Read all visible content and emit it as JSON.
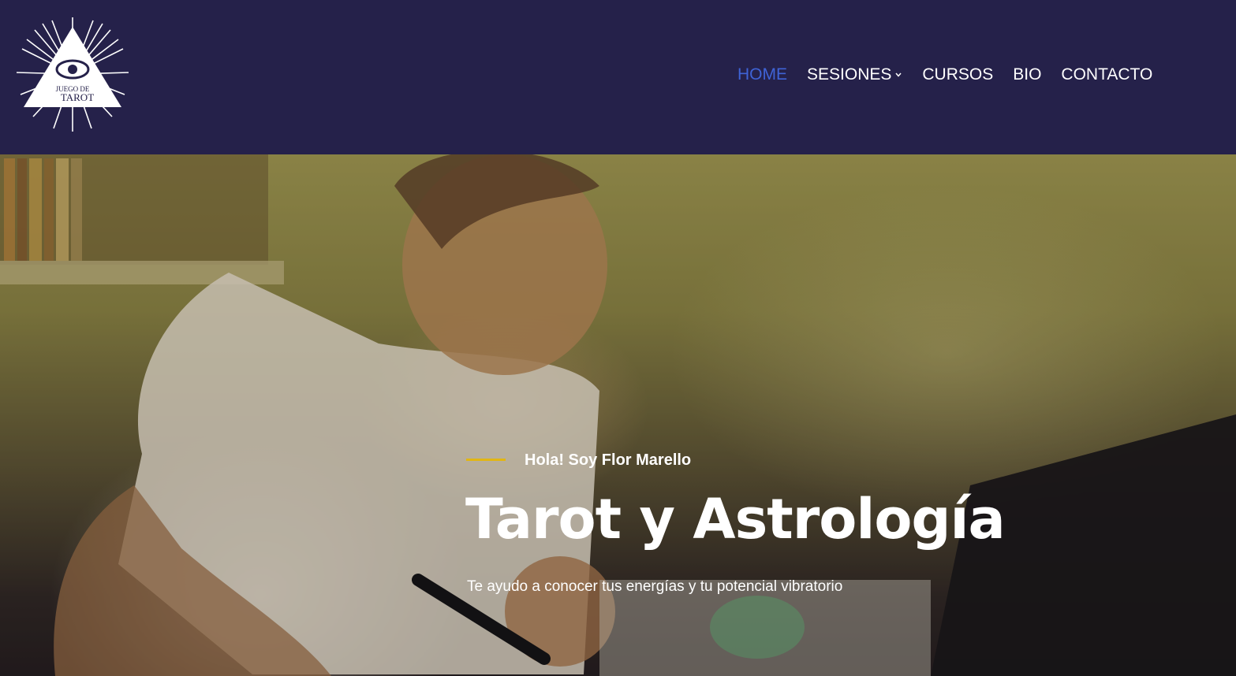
{
  "logo": {
    "line1": "JUEGO DE",
    "line2": "TAROT"
  },
  "nav": {
    "items": [
      {
        "label": "HOME",
        "active": true
      },
      {
        "label": "SESIONES",
        "has_dropdown": true
      },
      {
        "label": "CURSOS"
      },
      {
        "label": "BIO"
      },
      {
        "label": "CONTACTO"
      }
    ]
  },
  "hero": {
    "kicker": "Hola! Soy Flor Marello",
    "title": "Tarot y Astrología",
    "subtitle": "Te ayudo a conocer tus energías y tu potencial vibratorio"
  },
  "colors": {
    "header_bg": "#25214a",
    "nav_active": "#3f63d6",
    "accent_line": "#e2b613"
  },
  "icons": [
    "sunburst-eye-logo-icon",
    "chevron-down-icon"
  ]
}
